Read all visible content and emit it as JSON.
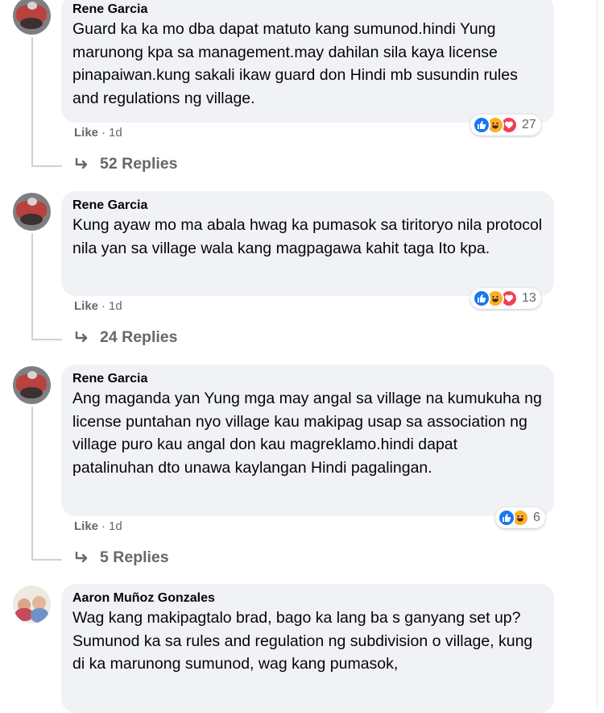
{
  "colors": {
    "like": "#1877f2",
    "haha": "#f7b125",
    "love": "#f33e58",
    "bubble": "#f0f2f5",
    "secondary": "#65676b"
  },
  "comments": [
    {
      "author": "Rene Garcia",
      "text": "Guard ka ka mo dba dapat matuto kang sumunod.hindi Yung marunong kpa sa management.may dahilan sila kaya license pinapaiwan.kung sakali ikaw guard don Hindi mb susundin rules and regulations ng village.",
      "reaction_icons": [
        "like-icon",
        "haha-icon",
        "love-icon"
      ],
      "reaction_count": "27",
      "like_label": "Like",
      "time": "1d",
      "replies_label": "52 Replies"
    },
    {
      "author": "Rene Garcia",
      "text": "Kung ayaw mo ma abala hwag ka pumasok sa tiritoryo nila protocol nila yan sa village wala kang magpagawa kahit taga Ito kpa.",
      "reaction_icons": [
        "like-icon",
        "haha-icon",
        "love-icon"
      ],
      "reaction_count": "13",
      "like_label": "Like",
      "time": "1d",
      "replies_label": "24 Replies"
    },
    {
      "author": "Rene Garcia",
      "text": "Ang maganda yan Yung mga may angal sa village na kumukuha ng license puntahan nyo village kau makipag usap sa association ng village puro kau angal don kau magreklamo.hindi dapat patalinuhan dto unawa kaylangan Hindi pagalingan.",
      "reaction_icons": [
        "like-icon",
        "haha-icon"
      ],
      "reaction_count": "6",
      "like_label": "Like",
      "time": "1d",
      "replies_label": "5 Replies"
    },
    {
      "author": "Aaron Muñoz Gonzales",
      "text": "Wag kang makipagtalo brad, bago ka lang ba s ganyang set up? Sumunod ka sa rules and regulation ng subdivision o village, kung di ka marunong sumunod, wag kang pumasok,"
    }
  ]
}
